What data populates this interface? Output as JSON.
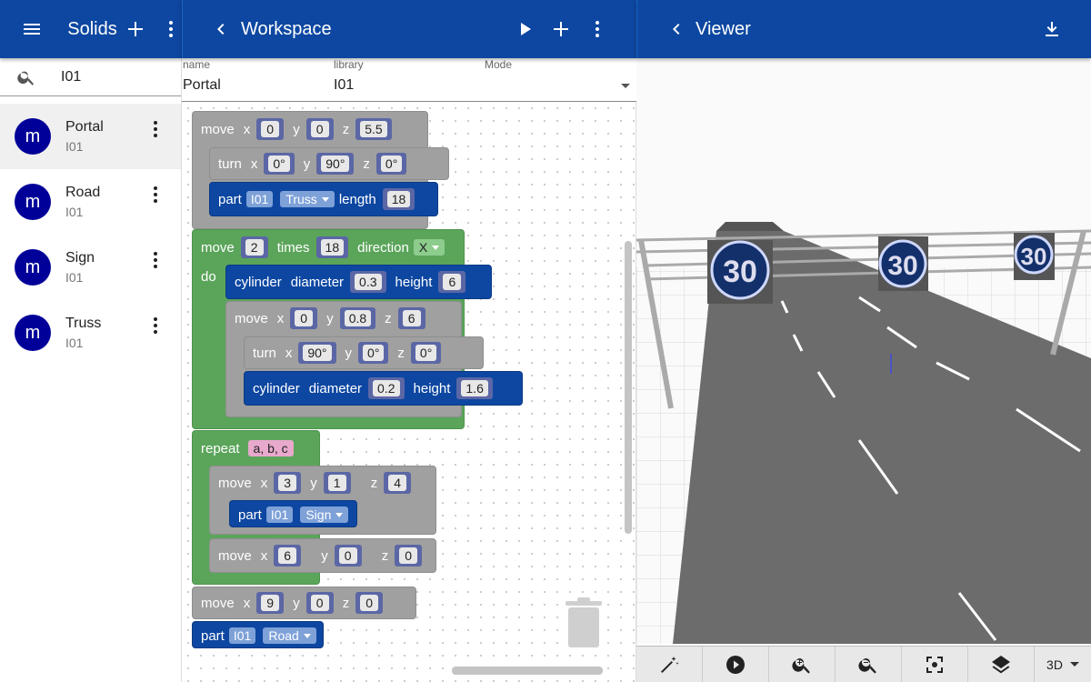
{
  "left_bar": {
    "title": "Solids"
  },
  "mid_bar": {
    "title": "Workspace"
  },
  "right_bar": {
    "title": "Viewer"
  },
  "search": {
    "value": "I01"
  },
  "solids": [
    {
      "name": "Portal",
      "library": "I01",
      "avatar": "m",
      "selected": true
    },
    {
      "name": "Road",
      "library": "I01",
      "avatar": "m"
    },
    {
      "name": "Sign",
      "library": "I01",
      "avatar": "m"
    },
    {
      "name": "Truss",
      "library": "I01",
      "avatar": "m"
    }
  ],
  "fields": {
    "name_label": "name",
    "name_value": "Portal",
    "library_label": "library",
    "library_value": "I01",
    "mode_label": "Mode"
  },
  "blocks": {
    "b1": {
      "kw": "move",
      "x": "x",
      "xv": "0",
      "y": "y",
      "yv": "0",
      "z": "z",
      "zv": "5.5"
    },
    "b2": {
      "kw": "turn",
      "x": "x",
      "xv": "0°",
      "y": "y",
      "yv": "90°",
      "z": "z",
      "zv": "0°"
    },
    "b3": {
      "kw": "part",
      "lib": "I01",
      "part": "Truss",
      "len": "length",
      "lenv": "18"
    },
    "b4": {
      "kw": "move",
      "n": "2",
      "times": "times",
      "tv": "18",
      "dir": "direction",
      "dv": "X",
      "do": "do"
    },
    "b5": {
      "kw": "cylinder",
      "dia": "diameter",
      "dv": "0.3",
      "h": "height",
      "hv": "6"
    },
    "b6": {
      "kw": "move",
      "x": "x",
      "xv": "0",
      "y": "y",
      "yv": "0.8",
      "z": "z",
      "zv": "6"
    },
    "b7": {
      "kw": "turn",
      "x": "x",
      "xv": "90°",
      "y": "y",
      "yv": "0°",
      "z": "z",
      "zv": "0°"
    },
    "b8": {
      "kw": "cylinder",
      "dia": "diameter",
      "dv": "0.2",
      "h": "height",
      "hv": "1.6"
    },
    "b9": {
      "kw": "repeat",
      "v": "a, b, c"
    },
    "b10": {
      "kw": "move",
      "x": "x",
      "xv": "3",
      "y": "y",
      "yv": "1",
      "z": "z",
      "zv": "4"
    },
    "b11": {
      "kw": "part",
      "lib": "I01",
      "part": "Sign"
    },
    "b12": {
      "kw": "move",
      "x": "x",
      "xv": "6",
      "y": "y",
      "yv": "0",
      "z": "z",
      "zv": "0"
    },
    "b13": {
      "kw": "move",
      "x": "x",
      "xv": "9",
      "y": "y",
      "yv": "0",
      "z": "z",
      "zv": "0"
    },
    "b14": {
      "kw": "part",
      "lib": "I01",
      "part": "Road"
    }
  },
  "viewer": {
    "sign_text": "30",
    "mode": "3D"
  },
  "colors": {
    "appbar": "#0d47a1",
    "avatar": "#000099",
    "block_blue": "#0d47a1",
    "block_green": "#5ba55b",
    "block_gray": "#a0a0a0"
  }
}
